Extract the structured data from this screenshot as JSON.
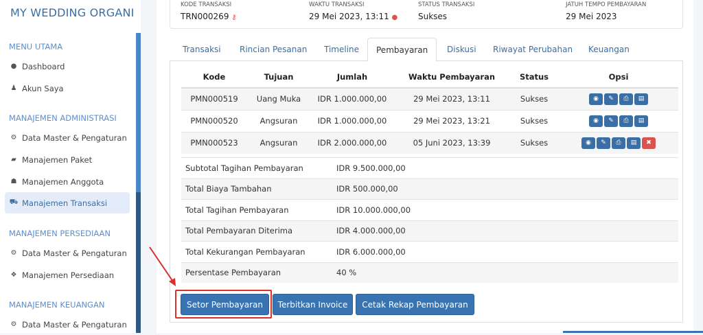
{
  "app": {
    "title": "MY WEDDING ORGANIZER"
  },
  "sidebar": {
    "sections": [
      {
        "title": "MENU UTAMA",
        "items": [
          {
            "label": "Dashboard",
            "icon": "globe-icon"
          },
          {
            "label": "Akun Saya",
            "icon": "user-icon"
          }
        ]
      },
      {
        "title": "MANAJEMEN ADMINISTRASI",
        "items": [
          {
            "label": "Data Master & Pengaturan",
            "icon": "gears-icon"
          },
          {
            "label": "Manajemen Paket",
            "icon": "book-icon"
          },
          {
            "label": "Manajemen Anggota",
            "icon": "users-icon"
          },
          {
            "label": "Manajemen Transaksi",
            "icon": "cart-icon"
          }
        ]
      },
      {
        "title": "MANAJEMEN PERSEDIAAN",
        "items": [
          {
            "label": "Data Master & Pengaturan",
            "icon": "gears-icon"
          },
          {
            "label": "Manajemen Persediaan",
            "icon": "cubes-icon"
          }
        ]
      },
      {
        "title": "MANAJEMEN KEUANGAN",
        "items": [
          {
            "label": "Data Master & Pengaturan",
            "icon": "gears-icon"
          }
        ]
      }
    ]
  },
  "info": [
    {
      "label": "KODE TRANSAKSI",
      "value": "TRN000269"
    },
    {
      "label": "WAKTU TRANSAKSI",
      "value": "29 Mei 2023, 13:11"
    },
    {
      "label": "STATUS TRANSAKSI",
      "value": "Sukses"
    },
    {
      "label": "JATUH TEMPO PEMBAYARAN",
      "value": "29 Mei 2023"
    }
  ],
  "tabs": [
    "Transaksi",
    "Rincian Pesanan",
    "Timeline",
    "Pembayaran",
    "Diskusi",
    "Riwayat Perubahan",
    "Keuangan"
  ],
  "table": {
    "headers": [
      "Kode",
      "Tujuan",
      "Jumlah",
      "Waktu Pembayaran",
      "Status",
      "Opsi"
    ],
    "rows": [
      [
        "PMN000519",
        "Uang Muka",
        "IDR 1.000.000,00",
        "29 Mei 2023, 13:11",
        "Sukses"
      ],
      [
        "PMN000520",
        "Angsuran",
        "IDR 1.000.000,00",
        "29 Mei 2023, 13:21",
        "Sukses"
      ],
      [
        "PMN000523",
        "Angsuran",
        "IDR 2.000.000,00",
        "05 Juni 2023, 13:39",
        "Sukses"
      ]
    ]
  },
  "summary": [
    [
      "Subtotal Tagihan Pembayaran",
      "IDR 9.500.000,00"
    ],
    [
      "Total Biaya Tambahan",
      "IDR 500.000,00"
    ],
    [
      "Total Tagihan Pembayaran",
      "IDR 10.000.000,00"
    ],
    [
      "Total Pembayaran Diterima",
      "IDR 4.000.000,00"
    ],
    [
      "Total Kekurangan Pembayaran",
      "IDR 6.000.000,00"
    ],
    [
      "Persentase Pembayaran",
      "40 %"
    ]
  ],
  "buttons": {
    "setor": "Setor Pembayaran",
    "terbitkan": "Terbitkan Invoice",
    "cetak": "Cetak Rekap Pembayaran"
  }
}
